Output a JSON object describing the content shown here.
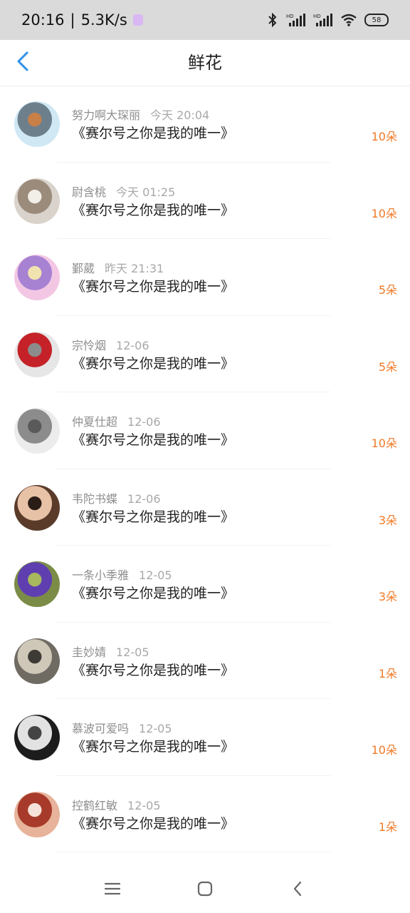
{
  "status": {
    "time": "20:16",
    "sep": "|",
    "speed": "5.3K/s",
    "battery": "58",
    "icons": [
      "bluetooth-icon",
      "signal-hd-icon",
      "signal-hd-icon",
      "wifi-icon",
      "battery-icon"
    ]
  },
  "header": {
    "title": "鲜花",
    "back_icon": "back-arrow-icon",
    "accent": "#2f8fe8"
  },
  "items": [
    {
      "name": "努力啊大琛丽",
      "time": "今天 20:04",
      "title": "《赛尔号之你是我的唯一》",
      "count": "10朵",
      "avatar": [
        "#cfe8f4",
        "#6e7f8c",
        "#c97f48"
      ]
    },
    {
      "name": "尉含桃",
      "time": "今天 01:25",
      "title": "《赛尔号之你是我的唯一》",
      "count": "10朵",
      "avatar": [
        "#d9d3cc",
        "#9b8b7b",
        "#f2efe8"
      ]
    },
    {
      "name": "鄞葳",
      "time": "昨天 21:31",
      "title": "《赛尔号之你是我的唯一》",
      "count": "5朵",
      "avatar": [
        "#f3c7e4",
        "#a781d2",
        "#f0e3b0"
      ]
    },
    {
      "name": "宗怜烟",
      "time": "12-06",
      "title": "《赛尔号之你是我的唯一》",
      "count": "5朵",
      "avatar": [
        "#e6e6e6",
        "#c42228",
        "#8c8c8c"
      ]
    },
    {
      "name": "仲夏仕超",
      "time": "12-06",
      "title": "《赛尔号之你是我的唯一》",
      "count": "10朵",
      "avatar": [
        "#ececec",
        "#8c8c8c",
        "#5a5a5a"
      ]
    },
    {
      "name": "韦陀书蝶",
      "time": "12-06",
      "title": "《赛尔号之你是我的唯一》",
      "count": "3朵",
      "avatar": [
        "#5a3b2a",
        "#e8c2a6",
        "#2a1d18"
      ]
    },
    {
      "name": "一条小季雅",
      "time": "12-05",
      "title": "《赛尔号之你是我的唯一》",
      "count": "3朵",
      "avatar": [
        "#7b8c47",
        "#5f3fb0",
        "#a7b85d"
      ]
    },
    {
      "name": "圭妙婧",
      "time": "12-05",
      "title": "《赛尔号之你是我的唯一》",
      "count": "1朵",
      "avatar": [
        "#6f6a62",
        "#cfc8b9",
        "#3e3a35"
      ]
    },
    {
      "name": "慕波可爱吗",
      "time": "12-05",
      "title": "《赛尔号之你是我的唯一》",
      "count": "10朵",
      "avatar": [
        "#1c1c1c",
        "#e2e2e2",
        "#444444"
      ]
    },
    {
      "name": "控鹤红敏",
      "time": "12-05",
      "title": "《赛尔号之你是我的唯一》",
      "count": "1朵",
      "avatar": [
        "#e7b39b",
        "#a73a2a",
        "#f5e2d8"
      ]
    }
  ],
  "nav": {
    "icons": [
      "menu-icon",
      "home-icon",
      "back-nav-icon"
    ]
  }
}
